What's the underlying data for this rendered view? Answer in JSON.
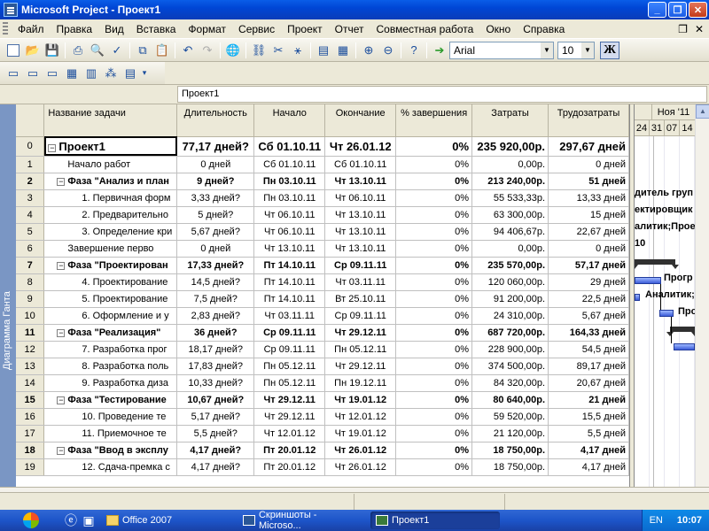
{
  "window": {
    "title": "Microsoft Project - Проект1"
  },
  "menu": {
    "items": [
      "Файл",
      "Правка",
      "Вид",
      "Вставка",
      "Формат",
      "Сервис",
      "Проект",
      "Отчет",
      "Совместная работа",
      "Окно",
      "Справка"
    ]
  },
  "toolbar": {
    "font": "Arial",
    "size": "10",
    "bold_label": "Ж"
  },
  "entry_bar": {
    "value": "Проект1"
  },
  "sidebar": {
    "label": "Диаграмма Ганта"
  },
  "table": {
    "headers": [
      "Название задачи",
      "Длительность",
      "Начало",
      "Окончание",
      "% завершения",
      "Затраты",
      "Трудозатраты"
    ],
    "rows": [
      {
        "id": "0",
        "name": "Проект1",
        "dur": "77,17 дней?",
        "start": "Сб 01.10.11",
        "end": "Чт 26.01.12",
        "pct": "0%",
        "cost": "235 920,00р.",
        "work": "297,67 дней",
        "kind": "project"
      },
      {
        "id": "1",
        "name": "Начало работ",
        "dur": "0 дней",
        "start": "Сб 01.10.11",
        "end": "Сб 01.10.11",
        "pct": "0%",
        "cost": "0,00р.",
        "work": "0 дней",
        "kind": "task1"
      },
      {
        "id": "2",
        "name": "Фаза \"Анализ и план",
        "dur": "9 дней?",
        "start": "Пн 03.10.11",
        "end": "Чт 13.10.11",
        "pct": "0%",
        "cost": "213 240,00р.",
        "work": "51 дней",
        "kind": "summary"
      },
      {
        "id": "3",
        "name": "1. Первичная форм",
        "dur": "3,33 дней?",
        "start": "Пн 03.10.11",
        "end": "Чт 06.10.11",
        "pct": "0%",
        "cost": "55 533,33р.",
        "work": "13,33 дней",
        "kind": "task2"
      },
      {
        "id": "4",
        "name": "2. Предварительно",
        "dur": "5 дней?",
        "start": "Чт 06.10.11",
        "end": "Чт 13.10.11",
        "pct": "0%",
        "cost": "63 300,00р.",
        "work": "15 дней",
        "kind": "task2"
      },
      {
        "id": "5",
        "name": "3. Определение кри",
        "dur": "5,67 дней?",
        "start": "Чт 06.10.11",
        "end": "Чт 13.10.11",
        "pct": "0%",
        "cost": "94 406,67р.",
        "work": "22,67 дней",
        "kind": "task2"
      },
      {
        "id": "6",
        "name": "Завершение перво",
        "dur": "0 дней",
        "start": "Чт 13.10.11",
        "end": "Чт 13.10.11",
        "pct": "0%",
        "cost": "0,00р.",
        "work": "0 дней",
        "kind": "task1"
      },
      {
        "id": "7",
        "name": "Фаза \"Проектирован",
        "dur": "17,33 дней?",
        "start": "Пт 14.10.11",
        "end": "Ср 09.11.11",
        "pct": "0%",
        "cost": "235 570,00р.",
        "work": "57,17 дней",
        "kind": "summary"
      },
      {
        "id": "8",
        "name": "4. Проектирование",
        "dur": "14,5 дней?",
        "start": "Пт 14.10.11",
        "end": "Чт 03.11.11",
        "pct": "0%",
        "cost": "120 060,00р.",
        "work": "29 дней",
        "kind": "task2"
      },
      {
        "id": "9",
        "name": "5. Проектирование",
        "dur": "7,5 дней?",
        "start": "Пт 14.10.11",
        "end": "Вт 25.10.11",
        "pct": "0%",
        "cost": "91 200,00р.",
        "work": "22,5 дней",
        "kind": "task2"
      },
      {
        "id": "10",
        "name": "6. Оформление и у",
        "dur": "2,83 дней?",
        "start": "Чт 03.11.11",
        "end": "Ср 09.11.11",
        "pct": "0%",
        "cost": "24 310,00р.",
        "work": "5,67 дней",
        "kind": "task2"
      },
      {
        "id": "11",
        "name": "Фаза \"Реализация\"",
        "dur": "36 дней?",
        "start": "Ср 09.11.11",
        "end": "Чт 29.12.11",
        "pct": "0%",
        "cost": "687 720,00р.",
        "work": "164,33 дней",
        "kind": "summary"
      },
      {
        "id": "12",
        "name": "7. Разработка прог",
        "dur": "18,17 дней?",
        "start": "Ср 09.11.11",
        "end": "Пн 05.12.11",
        "pct": "0%",
        "cost": "228 900,00р.",
        "work": "54,5 дней",
        "kind": "task2"
      },
      {
        "id": "13",
        "name": "8. Разработка поль",
        "dur": "17,83 дней?",
        "start": "Пн 05.12.11",
        "end": "Чт 29.12.11",
        "pct": "0%",
        "cost": "374 500,00р.",
        "work": "89,17 дней",
        "kind": "task2"
      },
      {
        "id": "14",
        "name": "9. Разработка диза",
        "dur": "10,33 дней?",
        "start": "Пн 05.12.11",
        "end": "Пн 19.12.11",
        "pct": "0%",
        "cost": "84 320,00р.",
        "work": "20,67 дней",
        "kind": "task2"
      },
      {
        "id": "15",
        "name": "Фаза \"Тестирование",
        "dur": "10,67 дней?",
        "start": "Чт 29.12.11",
        "end": "Чт 19.01.12",
        "pct": "0%",
        "cost": "80 640,00р.",
        "work": "21 дней",
        "kind": "summary"
      },
      {
        "id": "16",
        "name": "10. Проведение те",
        "dur": "5,17 дней?",
        "start": "Чт 29.12.11",
        "end": "Чт 12.01.12",
        "pct": "0%",
        "cost": "59 520,00р.",
        "work": "15,5 дней",
        "kind": "task2"
      },
      {
        "id": "17",
        "name": "11. Приемочное те",
        "dur": "5,5 дней?",
        "start": "Чт 12.01.12",
        "end": "Чт 19.01.12",
        "pct": "0%",
        "cost": "21 120,00р.",
        "work": "5,5 дней",
        "kind": "task2"
      },
      {
        "id": "18",
        "name": "Фаза \"Ввод в эксплу",
        "dur": "4,17 дней?",
        "start": "Пт 20.01.12",
        "end": "Чт 26.01.12",
        "pct": "0%",
        "cost": "18 750,00р.",
        "work": "4,17 дней",
        "kind": "summary"
      },
      {
        "id": "19",
        "name": "12. Сдача-премка с",
        "dur": "4,17 дней?",
        "start": "Пт 20.01.12",
        "end": "Чт 26.01.12",
        "pct": "0%",
        "cost": "18 750,00р.",
        "work": "4,17 дней",
        "kind": "task2"
      }
    ]
  },
  "gantt": {
    "month": "Ноя '11",
    "days": [
      "24",
      "31",
      "07",
      "14"
    ],
    "labels": [
      "дитель груп",
      "ектировщик",
      "алитик;Прое",
      "10",
      "Прогр",
      "Аналитик;",
      "Про"
    ]
  },
  "taskbar": {
    "tasks": [
      "Office 2007",
      "Скриншоты - Microso...",
      "Проект1"
    ],
    "lang": "EN",
    "clock": "10:07"
  }
}
